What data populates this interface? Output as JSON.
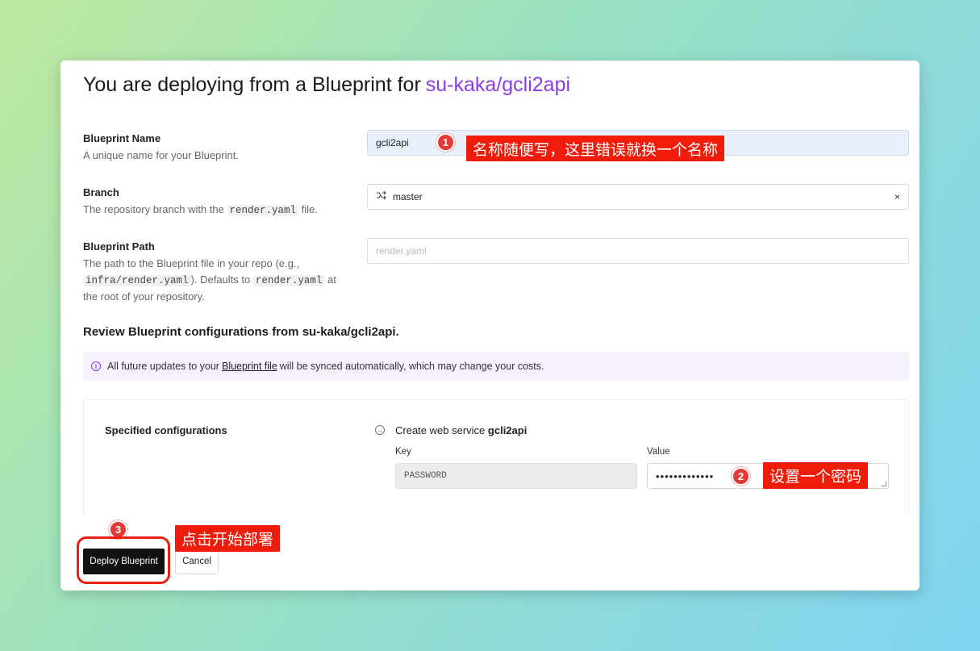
{
  "header": {
    "title_prefix": "You are deploying from a Blueprint for",
    "repo": "su-kaka/gcli2api"
  },
  "fields": {
    "blueprint_name": {
      "label": "Blueprint Name",
      "desc": "A unique name for your Blueprint.",
      "value": "gcli2api"
    },
    "branch": {
      "label": "Branch",
      "desc_pre": "The repository branch with the",
      "desc_code": "render.yaml",
      "desc_post": "file.",
      "value": "master",
      "icon": "git-branch-icon",
      "clear_glyph": "×"
    },
    "blueprint_path": {
      "label": "Blueprint Path",
      "desc_1": "The path to the Blueprint file in your repo (e.g.,",
      "desc_code_1": "infra/render.yaml",
      "desc_2": "). Defaults to",
      "desc_code_2": "render.yaml",
      "desc_3": "at",
      "desc_4": "the root of your repository.",
      "placeholder": "render.yaml"
    }
  },
  "review": {
    "title": "Review Blueprint configurations from su-kaka/gcli2api.",
    "info_pre": "All future updates to your",
    "info_link": "Blueprint file",
    "info_post": "will be synced automatically, which may change your costs."
  },
  "config": {
    "label": "Specified configurations",
    "create_pre": "Create web service",
    "create_name": "gcli2api",
    "key_header": "Key",
    "value_header": "Value",
    "key": "PASSWORD",
    "value_masked": "•••••••••••••"
  },
  "buttons": {
    "deploy": "Deploy Blueprint",
    "cancel": "Cancel"
  },
  "annotations": {
    "n1": "1",
    "c1": "名称随便写，这里错误就换一个名称",
    "n2": "2",
    "c2": "设置一个密码",
    "n3": "3",
    "c3": "点击开始部署"
  },
  "colors": {
    "accent": "#8a3ce8",
    "annotation_red": "#f01c0b"
  }
}
